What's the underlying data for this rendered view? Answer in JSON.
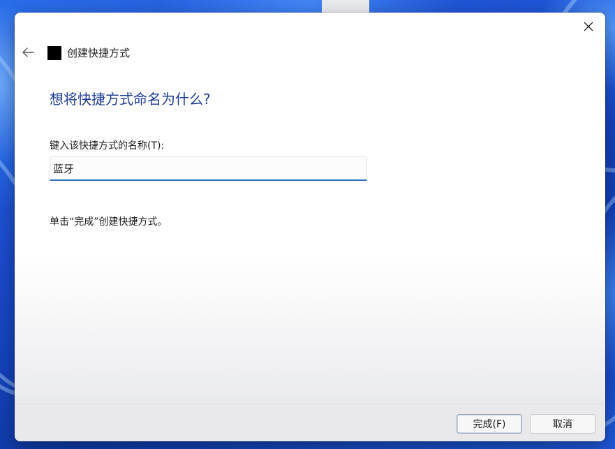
{
  "window": {
    "title": "创建快捷方式",
    "close_icon": "close-icon",
    "back_icon": "back-arrow-icon"
  },
  "page": {
    "heading": "想将快捷方式命名为什么?",
    "field_label": "键入该快捷方式的名称(T):",
    "name_value": "蓝牙",
    "instruction": "单击“完成”创建快捷方式。"
  },
  "footer": {
    "finish_label": "完成(F)",
    "cancel_label": "取消"
  },
  "colors": {
    "heading": "#1c3d93",
    "input_underline": "#2e6fc0"
  }
}
